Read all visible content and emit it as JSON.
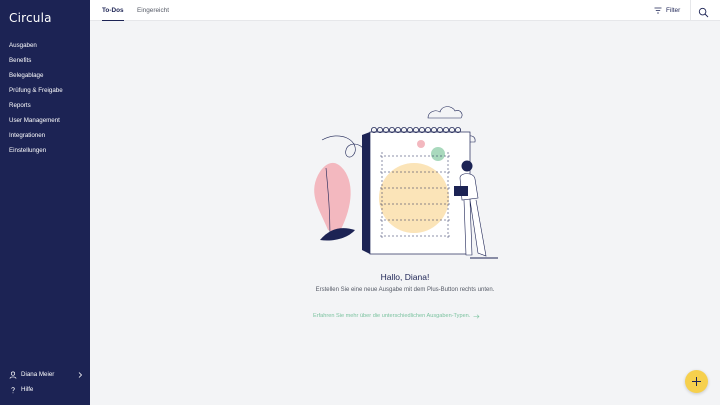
{
  "app": {
    "logo_text": "Circula"
  },
  "sidebar": {
    "items": [
      {
        "label": "Ausgaben"
      },
      {
        "label": "Benefits"
      },
      {
        "label": "Belegablage"
      },
      {
        "label": "Prüfung & Freigabe"
      },
      {
        "label": "Reports"
      },
      {
        "label": "User Management"
      },
      {
        "label": "Integrationen"
      },
      {
        "label": "Einstellungen"
      }
    ],
    "user_name": "Diana Meier",
    "help_label": "Hilfe",
    "icons": {
      "user": "user-icon",
      "help": "help-icon",
      "chevron": "chevron-right-icon"
    }
  },
  "topbar": {
    "tabs": [
      {
        "label": "To-Dos",
        "active": true
      },
      {
        "label": "Eingereicht",
        "active": false
      }
    ],
    "filter_label": "Filter",
    "icons": {
      "filter": "filter-icon",
      "search": "search-icon"
    }
  },
  "empty_state": {
    "greeting": "Hallo, Diana!",
    "message": "Erstellen Sie eine neue Ausgabe mit dem Plus-Button rechts unten.",
    "learn_more": "Erfahren Sie mehr über die unterschiedlichen Ausgaben-Typen.",
    "icons": {
      "arrow": "arrow-right-icon",
      "fab": "plus-icon"
    }
  },
  "colors": {
    "sidebar_bg": "#1c2354",
    "accent_green": "#7cc3a0",
    "fab_yellow": "#f6d04d",
    "pink": "#f3b8bf",
    "peach": "#fbe4b8",
    "content_bg": "#f3f4f6"
  }
}
